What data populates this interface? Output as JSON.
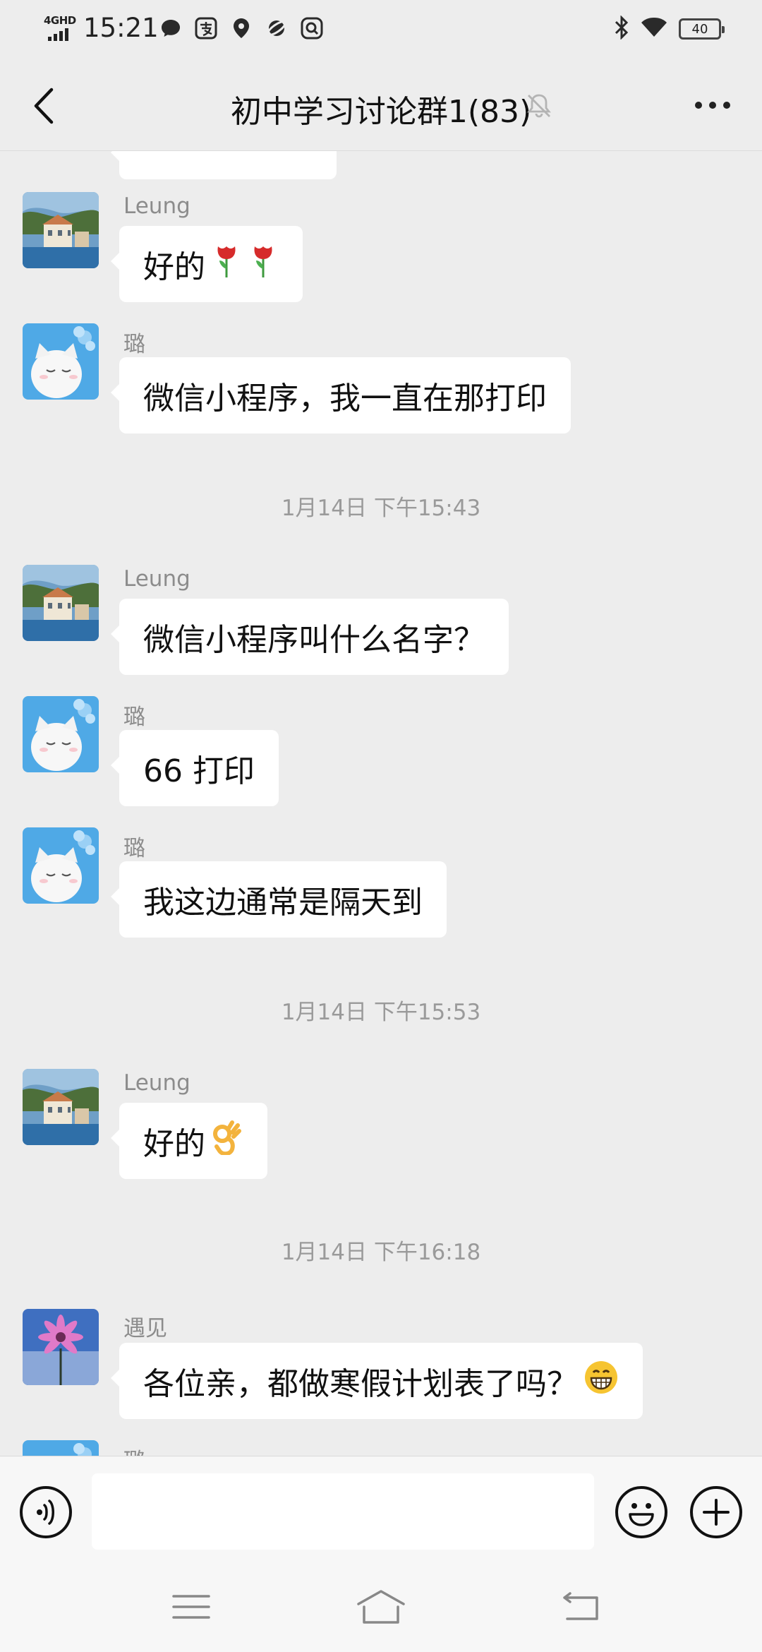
{
  "status_bar": {
    "network_label": "4GHD",
    "time": "15:21",
    "notification_icons": [
      "chat-bubble-icon",
      "alipay-icon",
      "location-pin-icon",
      "orbit-app-icon",
      "search-app-icon"
    ],
    "battery_level": "40"
  },
  "header": {
    "title": "初中学习讨论群1(83)",
    "muted": true
  },
  "messages": [
    {
      "kind": "partial-bubble"
    },
    {
      "kind": "message",
      "sender": "Leung",
      "avatar": "leung",
      "text": "好的",
      "emoji": [
        "tulip-emoji",
        "tulip-emoji"
      ]
    },
    {
      "kind": "message",
      "sender": "璐",
      "avatar": "lu",
      "text": "微信小程序，我一直在那打印"
    },
    {
      "kind": "timestamp",
      "text": "1月14日 下午15:43"
    },
    {
      "kind": "message",
      "sender": "Leung",
      "avatar": "leung",
      "text": "微信小程序叫什么名字？"
    },
    {
      "kind": "message",
      "sender": "璐",
      "avatar": "lu",
      "text": "66 打印"
    },
    {
      "kind": "message",
      "sender": "璐",
      "avatar": "lu",
      "text": "我这边通常是隔天到"
    },
    {
      "kind": "timestamp",
      "text": "1月14日 下午15:53"
    },
    {
      "kind": "message",
      "sender": "Leung",
      "avatar": "leung",
      "text": "好的",
      "emoji": [
        "ok-hand-emoji"
      ]
    },
    {
      "kind": "timestamp",
      "text": "1月14日 下午16:18"
    },
    {
      "kind": "message",
      "sender": "遇见",
      "avatar": "yujian",
      "text": "各位亲，都做寒假计划表了吗？",
      "emoji": [
        "grinning-face-emoji"
      ]
    },
    {
      "kind": "message",
      "sender": "璐",
      "avatar": "lu",
      "partial": true
    }
  ],
  "input": {
    "value": "",
    "placeholder": ""
  },
  "colors": {
    "background": "#ededed",
    "bubble": "#ffffff",
    "sender_text": "#8c8c8c",
    "timestamp_text": "#9a9a9a"
  }
}
